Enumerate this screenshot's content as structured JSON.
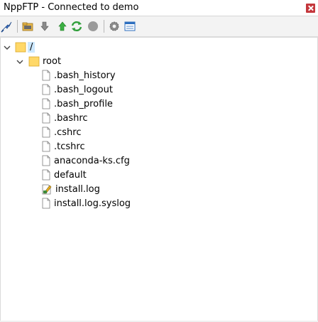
{
  "window": {
    "title": "NppFTP - Connected to demo"
  },
  "toolbar": {
    "buttons": [
      {
        "icon": "connect-icon"
      },
      {
        "icon": "open-folder-icon"
      },
      {
        "icon": "download-icon"
      },
      {
        "icon": "upload-icon"
      },
      {
        "icon": "refresh-icon"
      },
      {
        "icon": "abort-icon"
      },
      {
        "icon": "settings-icon"
      },
      {
        "icon": "message-window-icon"
      }
    ]
  },
  "tree": {
    "root": {
      "label": "/",
      "children": [
        {
          "label": "root",
          "children": [
            {
              "label": ".bash_history",
              "type": "file"
            },
            {
              "label": ".bash_logout",
              "type": "file"
            },
            {
              "label": ".bash_profile",
              "type": "file"
            },
            {
              "label": ".bashrc",
              "type": "file"
            },
            {
              "label": ".cshrc",
              "type": "file"
            },
            {
              "label": ".tcshrc",
              "type": "file"
            },
            {
              "label": "anaconda-ks.cfg",
              "type": "file"
            },
            {
              "label": "default",
              "type": "file"
            },
            {
              "label": "install.log",
              "type": "file-edited"
            },
            {
              "label": "install.log.syslog",
              "type": "file"
            }
          ]
        }
      ]
    }
  },
  "colors": {
    "selection": "#cce8ff",
    "folder": "#ffd868",
    "close": "#c4373c"
  }
}
